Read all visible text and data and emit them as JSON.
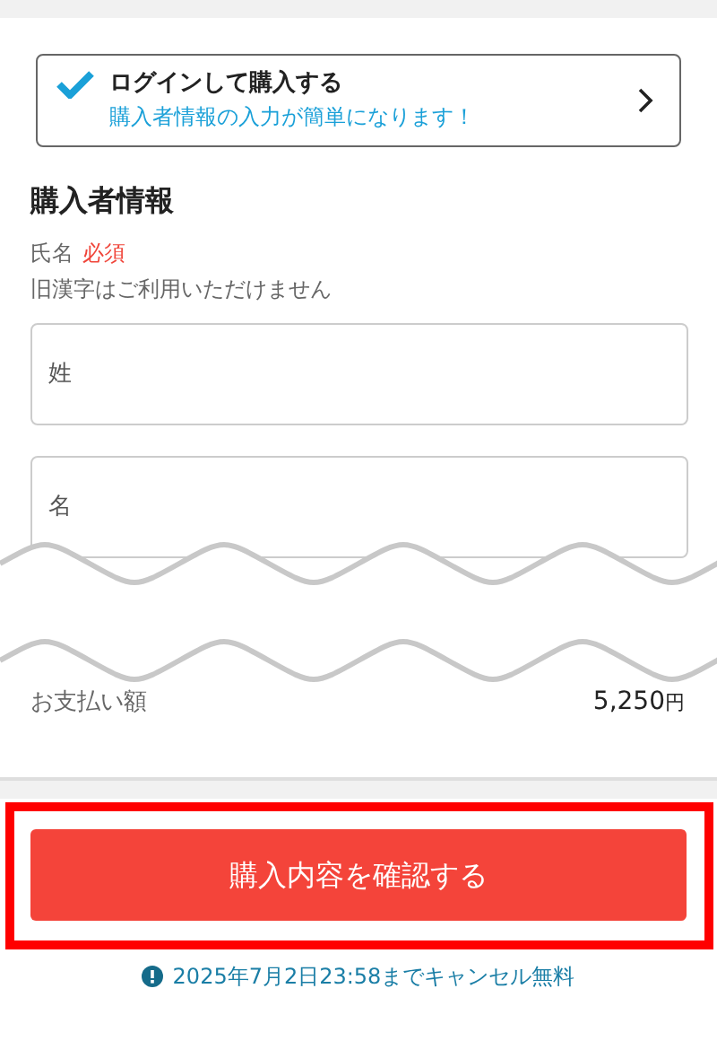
{
  "login_card": {
    "title": "ログインして購入する",
    "subtitle": "購入者情報の入力が簡単になります！"
  },
  "buyer_section": {
    "heading": "購入者情報",
    "field_label": "氏名",
    "required_badge": "必須",
    "note": "旧漢字はご利用いただけません",
    "fields": [
      {
        "placeholder": "姓"
      },
      {
        "placeholder": "名"
      }
    ]
  },
  "payment": {
    "label": "お支払い額",
    "amount": "5,250",
    "currency": "円"
  },
  "confirm_button": "購入内容を確認する",
  "cancel_notice": "2025年7月2日23:58までキャンセル無料"
}
